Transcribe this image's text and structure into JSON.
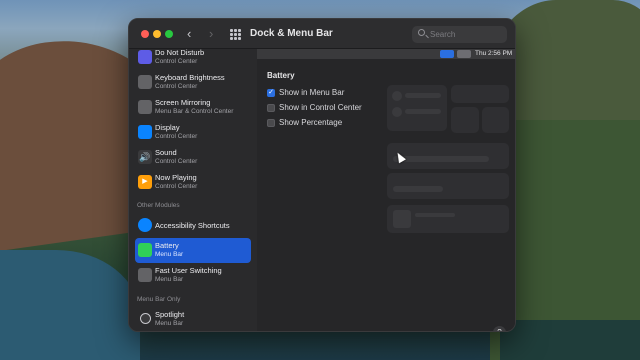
{
  "window": {
    "title": "Dock & Menu Bar"
  },
  "search": {
    "placeholder": "Search"
  },
  "menubar_preview": {
    "time": "Thu 2:56 PM"
  },
  "sidebar": {
    "items": [
      {
        "name": "Do Not Disturb",
        "sub": "Control Center",
        "icon": "moon-icon",
        "color": "#5e5ce6"
      },
      {
        "name": "Keyboard Brightness",
        "sub": "Control Center",
        "icon": "keyboard-brightness-icon",
        "color": "#8e8e93"
      },
      {
        "name": "Screen Mirroring",
        "sub": "Menu Bar & Control Center",
        "icon": "screen-mirroring-icon",
        "color": "#8e8e93"
      },
      {
        "name": "Display",
        "sub": "Control Center",
        "icon": "display-icon",
        "color": "#0a84ff"
      },
      {
        "name": "Sound",
        "sub": "Control Center",
        "icon": "speaker-icon",
        "color": "#3a3a3c"
      },
      {
        "name": "Now Playing",
        "sub": "Control Center",
        "icon": "play-icon",
        "color": "#ff9f0a"
      }
    ],
    "other_modules_label": "Other Modules",
    "other_items": [
      {
        "name": "Accessibility Shortcuts",
        "sub": "",
        "icon": "accessibility-icon",
        "color": "#0a84ff"
      },
      {
        "name": "Battery",
        "sub": "Menu Bar",
        "icon": "battery-icon",
        "color": "#30d158"
      },
      {
        "name": "Fast User Switching",
        "sub": "Menu Bar",
        "icon": "user-switching-icon",
        "color": "#8e8e93"
      }
    ],
    "menu_bar_only_label": "Menu Bar Only",
    "menu_bar_only_items": [
      {
        "name": "Spotlight",
        "sub": "Menu Bar",
        "icon": "spotlight-icon",
        "color": "#3a3a3c"
      }
    ]
  },
  "pane": {
    "title": "Battery",
    "options": [
      {
        "label": "Show in Menu Bar",
        "checked": true
      },
      {
        "label": "Show in Control Center",
        "checked": false
      },
      {
        "label": "Show Percentage",
        "checked": false
      }
    ],
    "help_label": "?"
  }
}
